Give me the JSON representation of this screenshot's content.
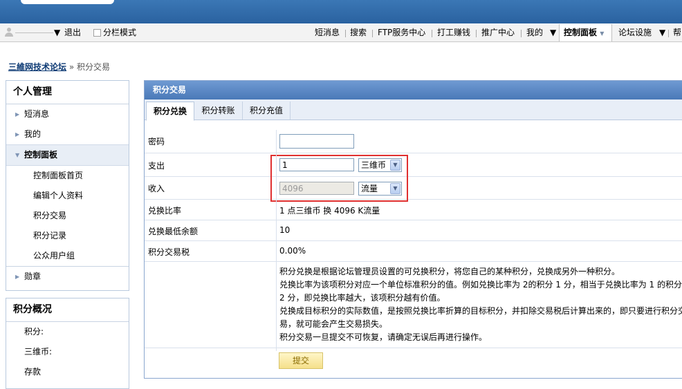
{
  "topbar": {
    "logout": "退出",
    "sidebar_mode": "分栏模式",
    "links": [
      "短消息",
      "搜索",
      "FTP服务中心",
      "打工赚钱",
      "推广中心",
      "我的",
      "控制面板",
      "论坛设施",
      "帮"
    ]
  },
  "breadcrumb": {
    "home": "三維网技术论坛",
    "separator": "»",
    "current": "积分交易"
  },
  "sidebar": {
    "title": "个人管理",
    "items": [
      {
        "label": "短消息"
      },
      {
        "label": "我的"
      },
      {
        "label": "控制面板"
      }
    ],
    "sub_items": [
      "控制面板首页",
      "编辑个人资料",
      "积分交易",
      "积分记录",
      "公众用户组"
    ],
    "medal": "勋章"
  },
  "overview": {
    "title": "积分概况",
    "stats": [
      "积分:",
      "三维币:",
      "存款"
    ]
  },
  "main": {
    "title": "积分交易",
    "tabs": [
      "积分兑换",
      "积分转账",
      "积分充值"
    ],
    "password_label": "密码",
    "pay_label": "支出",
    "pay_value": "1",
    "pay_currency": "三维币",
    "income_label": "收入",
    "income_value": "4096",
    "income_currency": "流量",
    "rate_label": "兑换比率",
    "rate_value": "1 点三维币 换 4096 K流量",
    "min_label": "兑换最低余额",
    "min_value": "10",
    "tax_label": "积分交易税",
    "tax_value": "0.00%",
    "desc": [
      "积分兑换是根据论坛管理员设置的可兑换积分，将您自己的某种积分，兑换成另外一种积分。",
      "兑换比率为该项积分对应一个单位标准积分的值。例如兑换比率为 2的积分 1 分，相当于兑换比率为 1 的积分",
      "2 分，即兑换比率越大，该项积分越有价值。",
      "兑换成目标积分的实际数值，是按照兑换比率折算的目标积分，并扣除交易税后计算出来的，即只要进行积分交",
      "易，就可能会产生交易损失。",
      "积分交易一旦提交不可恢复，请确定无误后再进行操作。"
    ],
    "submit": "提交"
  }
}
